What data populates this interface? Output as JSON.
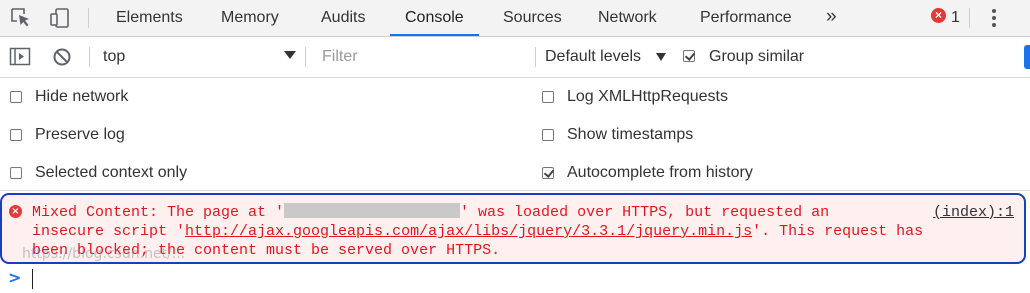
{
  "tabs": [
    {
      "label": "Elements"
    },
    {
      "label": "Memory"
    },
    {
      "label": "Audits"
    },
    {
      "label": "Console"
    },
    {
      "label": "Sources"
    },
    {
      "label": "Network"
    },
    {
      "label": "Performance"
    }
  ],
  "more_tabs_glyph": "»",
  "error_badge_glyph": "×",
  "error_count": "1",
  "toolbar": {
    "context": "top",
    "filter_placeholder": "Filter",
    "filter_value": "",
    "levels": "Default levels",
    "group_similar": {
      "label": "Group similar",
      "checked": true
    }
  },
  "settings_left": [
    {
      "label": "Hide network",
      "checked": false
    },
    {
      "label": "Preserve log",
      "checked": false
    },
    {
      "label": "Selected context only",
      "checked": false
    }
  ],
  "settings_right": [
    {
      "label": "Log XMLHttpRequests",
      "checked": false
    },
    {
      "label": "Show timestamps",
      "checked": false
    },
    {
      "label": "Autocomplete from history",
      "checked": true
    }
  ],
  "message": {
    "icon_glyph": "×",
    "part1": "Mixed Content: The page at '",
    "part2": "' was loaded over HTTPS, but requested an",
    "part3": "insecure script '",
    "url": "http://ajax.googleapis.com/ajax/libs/jquery/3.3.1/jquery.min.js",
    "part4": "'. This request has",
    "part5": "been blocked; the content must be served over HTTPS.",
    "source": "(index):1"
  },
  "watermark": "https://blog.csdn.net/...",
  "prompt_glyph": ">",
  "icons": [
    "inspect-element-icon",
    "device-toolbar-icon",
    "more-options-icon",
    "sidebar-toggle-icon",
    "clear-console-icon",
    "error-icon"
  ],
  "colors": {
    "accent": "#1a73e8",
    "error": "#e5151e",
    "error_bg": "#fff0f0",
    "highlight_border": "#1a3fb8"
  }
}
